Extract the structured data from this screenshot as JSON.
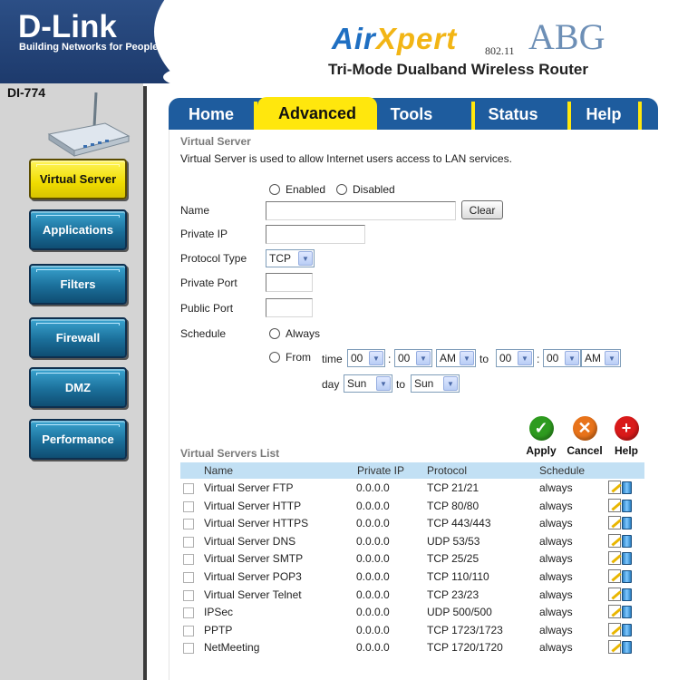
{
  "brand": {
    "logo": "D-Link",
    "tagline": "Building Networks for People",
    "product_name_a": "Air",
    "product_name_b": "Xpert",
    "product_suffix": "ABG",
    "standard": "802.11",
    "product_tagline": "Tri-Mode Dualband Wireless Router",
    "model": "DI-774"
  },
  "sidebar": {
    "items": [
      {
        "label": "Virtual Server",
        "active": true
      },
      {
        "label": "Applications",
        "active": false
      },
      {
        "label": "Filters",
        "active": false
      },
      {
        "label": "Firewall",
        "active": false
      },
      {
        "label": "DMZ",
        "active": false
      },
      {
        "label": "Performance",
        "active": false
      }
    ]
  },
  "tabs": [
    {
      "label": "Home",
      "active": false
    },
    {
      "label": "Advanced",
      "active": true
    },
    {
      "label": "Tools",
      "active": false
    },
    {
      "label": "Status",
      "active": false
    },
    {
      "label": "Help",
      "active": false
    }
  ],
  "form": {
    "title": "Virtual Server",
    "description": "Virtual Server is used to allow Internet users access to LAN services.",
    "enabled_label": "Enabled",
    "disabled_label": "Disabled",
    "name_label": "Name",
    "name_value": "",
    "clear_label": "Clear",
    "private_ip_label": "Private IP",
    "private_ip_value": "",
    "protocol_label": "Protocol Type",
    "protocol_value": "TCP",
    "private_port_label": "Private Port",
    "private_port_value": "",
    "public_port_label": "Public Port",
    "public_port_value": "",
    "schedule_label": "Schedule",
    "always_label": "Always",
    "from_label": "From",
    "time_label": "time",
    "colon": ":",
    "to_label": "to",
    "day_label": "day",
    "from_hour": "00",
    "from_minute": "00",
    "from_ampm": "AM",
    "to_hour": "00",
    "to_minute": "00",
    "to_ampm": "AM",
    "day_from": "Sun",
    "day_to": "Sun"
  },
  "actions": {
    "apply": "Apply",
    "cancel": "Cancel",
    "help": "Help",
    "apply_color": "#2e9b1f",
    "cancel_color": "#e8731a",
    "help_color": "#d91a1a"
  },
  "list": {
    "title": "Virtual Servers List",
    "columns": [
      "Name",
      "Private IP",
      "Protocol",
      "Schedule"
    ],
    "rows": [
      {
        "name": "Virtual Server FTP",
        "ip": "0.0.0.0",
        "protocol": "TCP 21/21",
        "schedule": "always"
      },
      {
        "name": "Virtual Server HTTP",
        "ip": "0.0.0.0",
        "protocol": "TCP 80/80",
        "schedule": "always"
      },
      {
        "name": "Virtual Server HTTPS",
        "ip": "0.0.0.0",
        "protocol": "TCP 443/443",
        "schedule": "always"
      },
      {
        "name": "Virtual Server DNS",
        "ip": "0.0.0.0",
        "protocol": "UDP 53/53",
        "schedule": "always"
      },
      {
        "name": "Virtual Server SMTP",
        "ip": "0.0.0.0",
        "protocol": "TCP 25/25",
        "schedule": "always"
      },
      {
        "name": "Virtual Server POP3",
        "ip": "0.0.0.0",
        "protocol": "TCP 110/110",
        "schedule": "always"
      },
      {
        "name": "Virtual Server Telnet",
        "ip": "0.0.0.0",
        "protocol": "TCP 23/23",
        "schedule": "always"
      },
      {
        "name": "IPSec",
        "ip": "0.0.0.0",
        "protocol": "UDP 500/500",
        "schedule": "always"
      },
      {
        "name": "PPTP",
        "ip": "0.0.0.0",
        "protocol": "TCP 1723/1723",
        "schedule": "always"
      },
      {
        "name": "NetMeeting",
        "ip": "0.0.0.0",
        "protocol": "TCP 1720/1720",
        "schedule": "always"
      }
    ]
  }
}
